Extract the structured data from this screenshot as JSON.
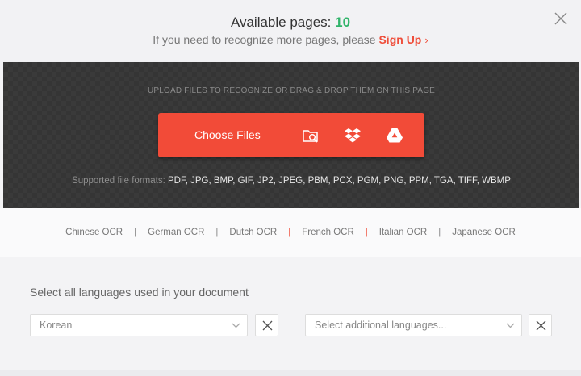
{
  "header": {
    "available_label": "Available pages:",
    "available_count": "10",
    "signup_prompt": "If you need to recognize more pages, please",
    "signup_link": "Sign Up",
    "close_icon": "close-icon"
  },
  "upload": {
    "hint": "UPLOAD FILES TO RECOGNIZE OR DRAG & DROP THEM ON THIS PAGE",
    "choose_label": "Choose Files",
    "icons": [
      "folder-search-icon",
      "dropbox-icon",
      "google-drive-icon"
    ],
    "formats_label": "Supported file formats:",
    "formats_list": "PDF, JPG, BMP, GIF, JP2, JPEG, PBM, PCX, PGM, PNG, PPM, TGA, TIFF, WBMP"
  },
  "ocr_links": [
    "Chinese OCR",
    "German OCR",
    "Dutch OCR",
    "French OCR",
    "Italian OCR",
    "Japanese OCR"
  ],
  "languages": {
    "title": "Select all languages used in your document",
    "primary_value": "Korean",
    "additional_placeholder": "Select additional languages..."
  },
  "colors": {
    "accent": "#f24b38",
    "count_green": "#31b46a",
    "dark_panel": "#3a3a3a"
  }
}
